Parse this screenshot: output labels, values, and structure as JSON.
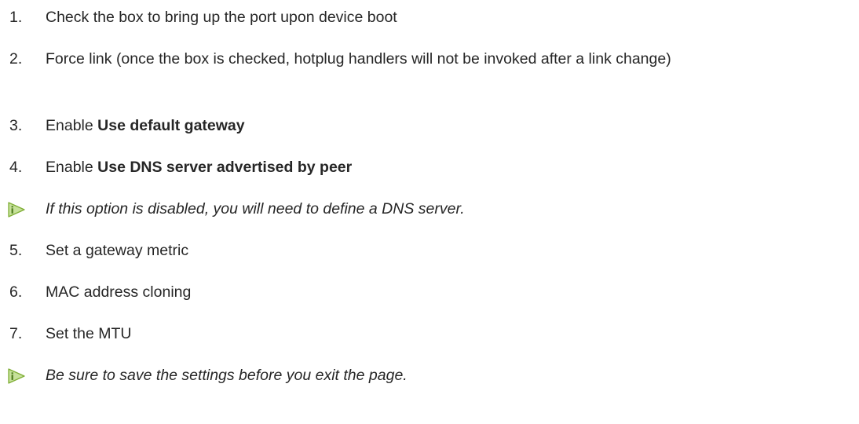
{
  "steps": [
    {
      "num": "1.",
      "text": "Check the box to bring up the port upon device boot"
    },
    {
      "num": "2.",
      "text": "Force link (once the box is checked, hotplug handlers will not be invoked after a link change)"
    },
    {
      "num": "3.",
      "prefix": "Enable ",
      "bold": "Use default gateway"
    },
    {
      "num": "4.",
      "prefix": "Enable ",
      "bold": "Use DNS server advertised by peer"
    },
    {
      "num": "5.",
      "text": "Set a gateway metric"
    },
    {
      "num": "6.",
      "text": "MAC address cloning"
    },
    {
      "num": "7.",
      "text": "Set the MTU"
    }
  ],
  "notes": [
    {
      "icon": "info-note-icon",
      "text": "If this option is disabled, you will need to define a DNS server."
    },
    {
      "icon": "info-note-icon",
      "text": "Be sure to save the settings before you exit the page."
    }
  ],
  "colors": {
    "text": "#262626",
    "note_icon_fill": "#c6e19a",
    "note_icon_stroke": "#7fae35",
    "note_icon_glyph": "#4f7d1e"
  }
}
